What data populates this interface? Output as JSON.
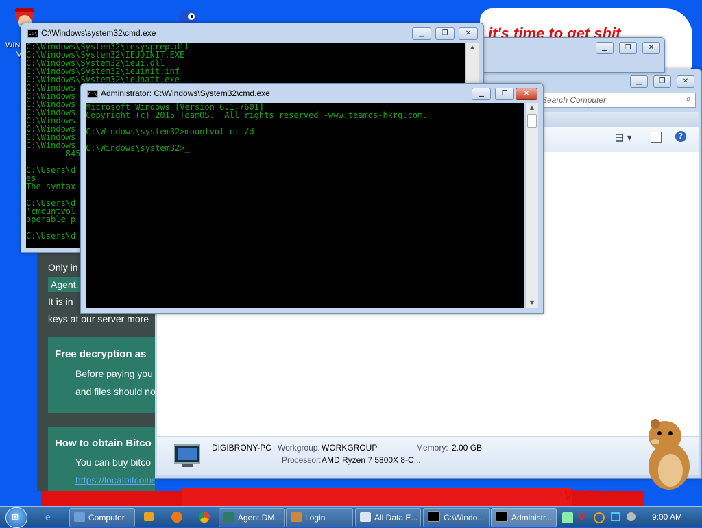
{
  "desktop": {
    "banner_text": "it's time to get shit",
    "band_text": "VMObot",
    "icon_label_1a": "WIN",
    "icon_label_1b": "V"
  },
  "cmd_back": {
    "title": "C:\\Windows\\system32\\cmd.exe",
    "lines": [
      "C:\\Windows\\System32\\iesysprep.dll",
      "C:\\Windows\\System32\\IEUDINIT.EXE",
      "C:\\Windows\\System32\\ieui.dll",
      "C:\\Windows\\System32\\ieuinit.inf",
      "C:\\Windows\\System32\\ieUnatt.exe",
      "C:\\Windows",
      "C:\\Windows",
      "C:\\Windows",
      "C:\\Windows",
      "C:\\Windows",
      "C:\\Windows",
      "C:\\Windows",
      "C:\\Windows",
      "        845",
      "",
      "C:\\Users\\d",
      "es",
      "The syntax",
      "",
      "C:\\Users\\d",
      "'cmountvol",
      "operable p",
      "",
      "C:\\Users\\d"
    ]
  },
  "cmd_front": {
    "title": "Administrator: C:\\Windows\\System32\\cmd.exe",
    "lines": [
      "Microsoft Windows [Version 6.1.7601]",
      "Copyright (c) 2015 TeamOS.  All rights reserved -www.teamos-hkrg.com.",
      "",
      "C:\\Windows\\system32>mountvol c: /d",
      "",
      "C:\\Windows\\system32>_"
    ]
  },
  "explorer": {
    "search_placeholder": "Search Computer",
    "computer_name": "DIGIBRONY-PC",
    "workgroup_label": "Workgroup:",
    "workgroup_value": "WORKGROUP",
    "memory_label": "Memory:",
    "memory_value": "2.00 GB",
    "processor_label": "Processor:",
    "processor_value": "AMD Ryzen 7 5800X 8-C..."
  },
  "ransom": {
    "line1": "Only in",
    "agent_chip": "Agent.",
    "line2": "It is in",
    "line3": "keys at our server more",
    "section1_title": "Free decryption as",
    "section1_text1": "Before paying you",
    "section1_text2": "and files should no",
    "section2_title": "How to obtain Bitco",
    "section2_text1": "You can buy bitco",
    "section2_link": "https://localbitcoins.com/buy_bitcoins"
  },
  "taskbar": {
    "buttons": [
      {
        "label": "Computer"
      },
      {
        "label": "Agent.DM..."
      },
      {
        "label": "Login"
      },
      {
        "label": "All Data E..."
      },
      {
        "label": "C:\\Windo..."
      },
      {
        "label": "Administr..."
      }
    ],
    "clock": "9:00 AM"
  },
  "colors": {
    "console_text": "#17a317",
    "desktop_bg": "#0a5cf0",
    "ransom_accent": "#2c7b69"
  }
}
